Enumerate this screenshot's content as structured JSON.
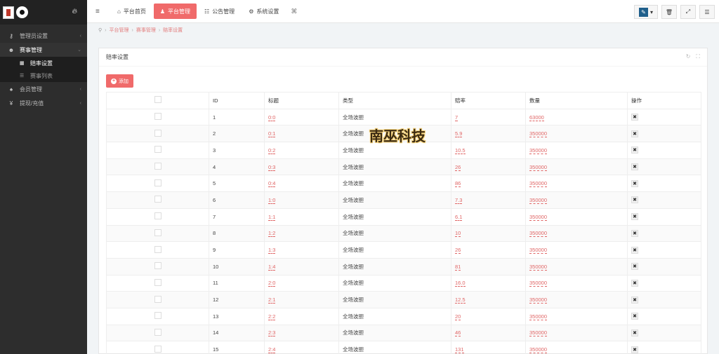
{
  "sidebar": {
    "items": [
      {
        "label": "管理员设置",
        "icon": "key-icon",
        "open": false
      },
      {
        "label": "赛事管理",
        "icon": "users-icon",
        "open": true,
        "children": [
          {
            "label": "赔率设置",
            "active": true
          },
          {
            "label": "赛事列表",
            "active": false
          }
        ]
      },
      {
        "label": "会员管理",
        "icon": "trophy-icon",
        "open": false
      },
      {
        "label": "提现/充值",
        "icon": "money-icon",
        "open": false
      }
    ]
  },
  "topbar": {
    "tabs": [
      {
        "label": "平台首页",
        "icon": "home-icon",
        "active": false
      },
      {
        "label": "平台管理",
        "icon": "user-icon",
        "active": true
      },
      {
        "label": "公告管理",
        "icon": "list-icon",
        "active": false
      },
      {
        "label": "系统设置",
        "icon": "gear-icon",
        "active": false
      }
    ]
  },
  "breadcrumb": [
    "平台管理",
    "赛事管理",
    "赔率设置"
  ],
  "panel": {
    "title": "赔率设置",
    "add_label": "添加"
  },
  "table": {
    "headers": [
      "ID",
      "标题",
      "类型",
      "赔率",
      "数量",
      "操作"
    ],
    "rows": [
      {
        "id": "1",
        "title": "0:0",
        "type": "全场波胆",
        "odds": "7",
        "qty": "63000"
      },
      {
        "id": "2",
        "title": "0:1",
        "type": "全场波胆",
        "odds": "5.9",
        "qty": "350000"
      },
      {
        "id": "3",
        "title": "0:2",
        "type": "全场波胆",
        "odds": "10.5",
        "qty": "350000"
      },
      {
        "id": "4",
        "title": "0:3",
        "type": "全场波胆",
        "odds": "26",
        "qty": "350000"
      },
      {
        "id": "5",
        "title": "0:4",
        "type": "全场波胆",
        "odds": "86",
        "qty": "350000"
      },
      {
        "id": "6",
        "title": "1:0",
        "type": "全场波胆",
        "odds": "7.3",
        "qty": "350000"
      },
      {
        "id": "7",
        "title": "1:1",
        "type": "全场波胆",
        "odds": "6.1",
        "qty": "350000"
      },
      {
        "id": "8",
        "title": "1:2",
        "type": "全场波胆",
        "odds": "10",
        "qty": "350000"
      },
      {
        "id": "9",
        "title": "1:3",
        "type": "全场波胆",
        "odds": "26",
        "qty": "350000"
      },
      {
        "id": "10",
        "title": "1:4",
        "type": "全场波胆",
        "odds": "81",
        "qty": "350000"
      },
      {
        "id": "11",
        "title": "2:0",
        "type": "全场波胆",
        "odds": "16.0",
        "qty": "350000"
      },
      {
        "id": "12",
        "title": "2:1",
        "type": "全场波胆",
        "odds": "12.5",
        "qty": "350000"
      },
      {
        "id": "13",
        "title": "2:2",
        "type": "全场波胆",
        "odds": "20",
        "qty": "350000"
      },
      {
        "id": "14",
        "title": "2:3",
        "type": "全场波胆",
        "odds": "46",
        "qty": "350000"
      },
      {
        "id": "15",
        "title": "2:4",
        "type": "全场波胆",
        "odds": "131",
        "qty": "350000"
      }
    ]
  },
  "watermark": "南巫科技",
  "colors": {
    "accent": "#f06a6a",
    "sidebar": "#2d2d2d",
    "link": "#e06666"
  }
}
